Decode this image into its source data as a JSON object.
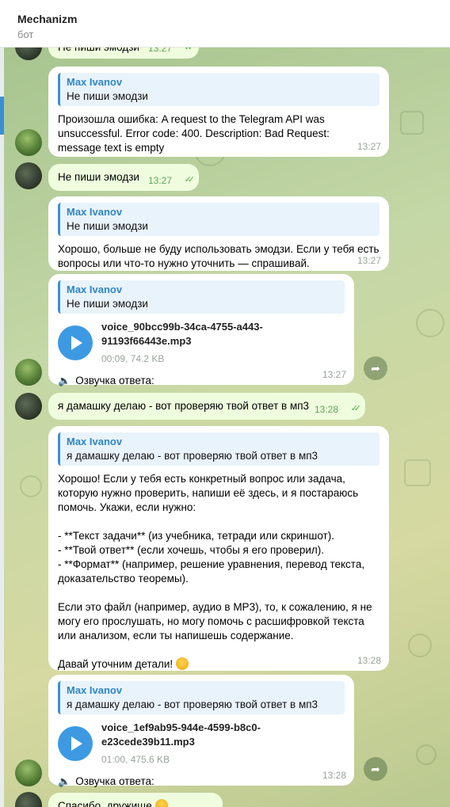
{
  "header": {
    "title": "Mechanizm",
    "subtitle": "бот"
  },
  "messages": {
    "m0": {
      "text": "Не пиши эмодзи",
      "time": "13:27"
    },
    "m1": {
      "reply_name": "Max Ivanov",
      "reply_text": "Не пиши эмодзи",
      "text": "Произошла ошибка: A request to the Telegram API was unsuccessful. Error code: 400. Description: Bad Request: message text is empty",
      "time": "13:27"
    },
    "m2": {
      "text": "Не пиши эмодзи",
      "time": "13:27"
    },
    "m3": {
      "reply_name": "Max Ivanov",
      "reply_text": "Не пиши эмодзи",
      "text": "Хорошо, больше не буду использовать эмодзи. Если у тебя есть вопросы или что-то нужно уточнить — спрашивай.",
      "time": "13:27"
    },
    "m4": {
      "reply_name": "Max Ivanov",
      "reply_text": "Не пиши эмодзи",
      "file_name": "voice_90bcc99b-34ca-4755-a443-91193f66443e.mp3",
      "file_size": "00:09, 74.2 KB",
      "caption": "Озвучка ответа:",
      "time": "13:27"
    },
    "m5": {
      "text": "я дамашку делаю - вот проверяю твой ответ в мп3",
      "time": "13:28"
    },
    "m6": {
      "reply_name": "Max Ivanov",
      "reply_text": "я дамашку делаю - вот проверяю твой ответ в мп3",
      "text": "Хорошо! Если у тебя есть конкретный вопрос или задача, которую нужно проверить, напиши её здесь, и я постараюсь помочь. Укажи, если нужно:\n\n- **Текст задачи** (из учебника, тетради или скриншот).\n- **Твой ответ** (если хочешь, чтобы я его проверил).\n- **Формат** (например, решение уравнения, перевод текста, доказательство теоремы).\n\nЕсли это файл (например, аудио в MP3), то, к сожалению, я не могу его прослушать, но могу помочь с расшифровкой текста или анализом, если ты напишешь содержание.\n\nДавай уточним детали! ",
      "time": "13:28"
    },
    "m7": {
      "reply_name": "Max Ivanov",
      "reply_text": "я дамашку делаю - вот проверяю твой ответ в мп3",
      "file_name": "voice_1ef9ab95-944e-4599-b8c0-e23cede39b11.mp3",
      "file_size": "01:00, 475.6 KB",
      "caption": "Озвучка ответа:",
      "time": "13:28"
    },
    "m8": {
      "text": "Спасибо, дружище"
    }
  },
  "icons": {
    "checks": "✓✓",
    "play": "play-icon",
    "speaker": "🔈",
    "share": "➦",
    "emoji": "smiling-face-emoji"
  },
  "colors": {
    "accent": "#3a90cf",
    "outgoing_bubble": "#effdde",
    "incoming_bubble": "#ffffff",
    "play_button": "#3d9ae2",
    "check_marks": "#4fae4e"
  }
}
